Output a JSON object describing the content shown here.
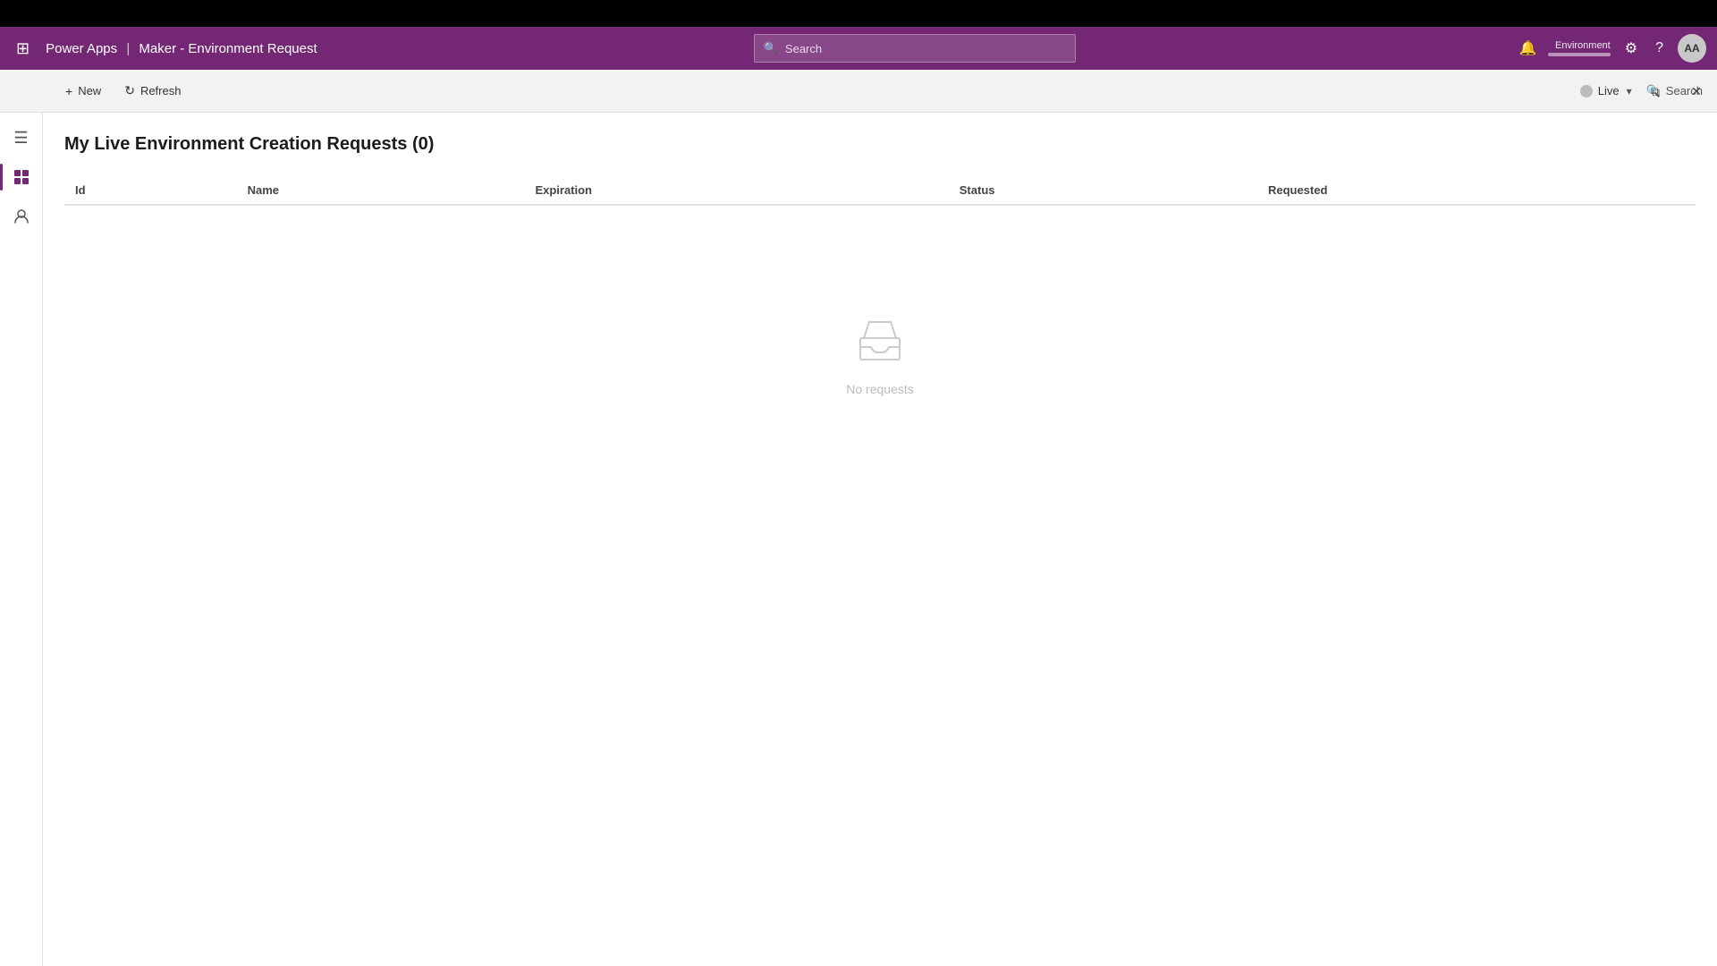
{
  "topBar": {},
  "navBar": {
    "waffle_icon": "⊞",
    "app_name": "Power Apps",
    "separator": "|",
    "sub_title": "Maker - Environment Request",
    "search_placeholder": "Search",
    "env_label": "Environment",
    "avatar_initials": "AA"
  },
  "toolbar": {
    "new_label": "New",
    "refresh_label": "Refresh",
    "live_label": "Live",
    "search_label": "Search"
  },
  "page": {
    "title": "My Live Environment Creation Requests (0)"
  },
  "table": {
    "columns": [
      "Id",
      "Name",
      "Expiration",
      "Status",
      "Requested"
    ]
  },
  "emptyState": {
    "text": "No requests"
  },
  "windowControls": {
    "restore": "⧉",
    "close": "✕"
  }
}
